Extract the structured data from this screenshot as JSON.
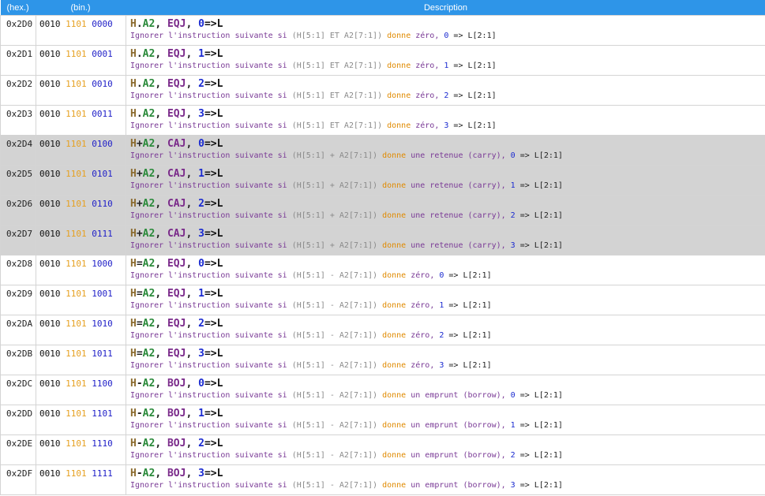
{
  "header": {
    "hex": "(hex.)",
    "bin": "(bin.)",
    "description": "Description"
  },
  "rows": [
    {
      "hex": "0x2D0",
      "bin": [
        "0010",
        "1101",
        "0000"
      ],
      "mn": {
        "h": "H",
        "op": ".",
        "a2": "A2",
        "sep1": ", ",
        "cmd": "EQJ",
        "sep2": ", ",
        "num": "0",
        "arr": "=>L"
      },
      "d": {
        "t1": "Ignorer l'instruction suivante si ",
        "expr": "(H[5:1] ET A2[7:1])",
        "donne": " donne ",
        "t2": "zéro, ",
        "num": "0",
        "dest": " => L[2:1]"
      },
      "grey": false
    },
    {
      "hex": "0x2D1",
      "bin": [
        "0010",
        "1101",
        "0001"
      ],
      "mn": {
        "h": "H",
        "op": ".",
        "a2": "A2",
        "sep1": ", ",
        "cmd": "EQJ",
        "sep2": ", ",
        "num": "1",
        "arr": "=>L"
      },
      "d": {
        "t1": "Ignorer l'instruction suivante si ",
        "expr": "(H[5:1] ET A2[7:1])",
        "donne": " donne ",
        "t2": "zéro, ",
        "num": "1",
        "dest": " => L[2:1]"
      },
      "grey": false
    },
    {
      "hex": "0x2D2",
      "bin": [
        "0010",
        "1101",
        "0010"
      ],
      "mn": {
        "h": "H",
        "op": ".",
        "a2": "A2",
        "sep1": ", ",
        "cmd": "EQJ",
        "sep2": ", ",
        "num": "2",
        "arr": "=>L"
      },
      "d": {
        "t1": "Ignorer l'instruction suivante si ",
        "expr": "(H[5:1] ET A2[7:1])",
        "donne": " donne ",
        "t2": "zéro, ",
        "num": "2",
        "dest": " => L[2:1]"
      },
      "grey": false
    },
    {
      "hex": "0x2D3",
      "bin": [
        "0010",
        "1101",
        "0011"
      ],
      "mn": {
        "h": "H",
        "op": ".",
        "a2": "A2",
        "sep1": ", ",
        "cmd": "EQJ",
        "sep2": ", ",
        "num": "3",
        "arr": "=>L"
      },
      "d": {
        "t1": "Ignorer l'instruction suivante si ",
        "expr": "(H[5:1] ET A2[7:1])",
        "donne": " donne ",
        "t2": "zéro, ",
        "num": "3",
        "dest": " => L[2:1]"
      },
      "grey": false
    },
    {
      "hex": "0x2D4",
      "bin": [
        "0010",
        "1101",
        "0100"
      ],
      "mn": {
        "h": "H",
        "op": "+",
        "a2": "A2",
        "sep1": ", ",
        "cmd": "CAJ",
        "sep2": ", ",
        "num": "0",
        "arr": "=>L"
      },
      "d": {
        "t1": "Ignorer l'instruction suivante si ",
        "expr": "(H[5:1] + A2[7:1])",
        "donne": " donne ",
        "t2": "une retenue (carry), ",
        "num": "0",
        "dest": " => L[2:1]"
      },
      "grey": true
    },
    {
      "hex": "0x2D5",
      "bin": [
        "0010",
        "1101",
        "0101"
      ],
      "mn": {
        "h": "H",
        "op": "+",
        "a2": "A2",
        "sep1": ", ",
        "cmd": "CAJ",
        "sep2": ", ",
        "num": "1",
        "arr": "=>L"
      },
      "d": {
        "t1": "Ignorer l'instruction suivante si ",
        "expr": "(H[5:1] + A2[7:1])",
        "donne": " donne ",
        "t2": "une retenue (carry), ",
        "num": "1",
        "dest": " => L[2:1]"
      },
      "grey": true
    },
    {
      "hex": "0x2D6",
      "bin": [
        "0010",
        "1101",
        "0110"
      ],
      "mn": {
        "h": "H",
        "op": "+",
        "a2": "A2",
        "sep1": ", ",
        "cmd": "CAJ",
        "sep2": ", ",
        "num": "2",
        "arr": "=>L"
      },
      "d": {
        "t1": "Ignorer l'instruction suivante si ",
        "expr": "(H[5:1] + A2[7:1])",
        "donne": " donne ",
        "t2": "une retenue (carry), ",
        "num": "2",
        "dest": " => L[2:1]"
      },
      "grey": true
    },
    {
      "hex": "0x2D7",
      "bin": [
        "0010",
        "1101",
        "0111"
      ],
      "mn": {
        "h": "H",
        "op": "+",
        "a2": "A2",
        "sep1": ", ",
        "cmd": "CAJ",
        "sep2": ", ",
        "num": "3",
        "arr": "=>L"
      },
      "d": {
        "t1": "Ignorer l'instruction suivante si ",
        "expr": "(H[5:1] + A2[7:1])",
        "donne": " donne ",
        "t2": "une retenue (carry), ",
        "num": "3",
        "dest": " => L[2:1]"
      },
      "grey": true
    },
    {
      "hex": "0x2D8",
      "bin": [
        "0010",
        "1101",
        "1000"
      ],
      "mn": {
        "h": "H",
        "op": "=",
        "a2": "A2",
        "sep1": ", ",
        "cmd": "EQJ",
        "sep2": ", ",
        "num": "0",
        "arr": "=>L"
      },
      "d": {
        "t1": "Ignorer l'instruction suivante si ",
        "expr": "(H[5:1] - A2[7:1])",
        "donne": " donne ",
        "t2": "zéro, ",
        "num": "0",
        "dest": " => L[2:1]"
      },
      "grey": false
    },
    {
      "hex": "0x2D9",
      "bin": [
        "0010",
        "1101",
        "1001"
      ],
      "mn": {
        "h": "H",
        "op": "=",
        "a2": "A2",
        "sep1": ", ",
        "cmd": "EQJ",
        "sep2": ", ",
        "num": "1",
        "arr": "=>L"
      },
      "d": {
        "t1": "Ignorer l'instruction suivante si ",
        "expr": "(H[5:1] - A2[7:1])",
        "donne": " donne ",
        "t2": "zéro, ",
        "num": "1",
        "dest": " => L[2:1]"
      },
      "grey": false
    },
    {
      "hex": "0x2DA",
      "bin": [
        "0010",
        "1101",
        "1010"
      ],
      "mn": {
        "h": "H",
        "op": "=",
        "a2": "A2",
        "sep1": ", ",
        "cmd": "EQJ",
        "sep2": ", ",
        "num": "2",
        "arr": "=>L"
      },
      "d": {
        "t1": "Ignorer l'instruction suivante si ",
        "expr": "(H[5:1] - A2[7:1])",
        "donne": " donne ",
        "t2": "zéro, ",
        "num": "2",
        "dest": " => L[2:1]"
      },
      "grey": false
    },
    {
      "hex": "0x2DB",
      "bin": [
        "0010",
        "1101",
        "1011"
      ],
      "mn": {
        "h": "H",
        "op": "=",
        "a2": "A2",
        "sep1": ", ",
        "cmd": "EQJ",
        "sep2": ", ",
        "num": "3",
        "arr": "=>L"
      },
      "d": {
        "t1": "Ignorer l'instruction suivante si ",
        "expr": "(H[5:1] - A2[7:1])",
        "donne": " donne ",
        "t2": "zéro, ",
        "num": "3",
        "dest": " => L[2:1]"
      },
      "grey": false
    },
    {
      "hex": "0x2DC",
      "bin": [
        "0010",
        "1101",
        "1100"
      ],
      "mn": {
        "h": "H",
        "op": "-",
        "a2": "A2",
        "sep1": ", ",
        "cmd": "BOJ",
        "sep2": ", ",
        "num": "0",
        "arr": "=>L"
      },
      "d": {
        "t1": "Ignorer l'instruction suivante si ",
        "expr": "(H[5:1] - A2[7:1])",
        "donne": " donne ",
        "t2": "un emprunt (borrow), ",
        "num": "0",
        "dest": " => L[2:1]"
      },
      "grey": false
    },
    {
      "hex": "0x2DD",
      "bin": [
        "0010",
        "1101",
        "1101"
      ],
      "mn": {
        "h": "H",
        "op": "-",
        "a2": "A2",
        "sep1": ", ",
        "cmd": "BOJ",
        "sep2": ", ",
        "num": "1",
        "arr": "=>L"
      },
      "d": {
        "t1": "Ignorer l'instruction suivante si ",
        "expr": "(H[5:1] - A2[7:1])",
        "donne": " donne ",
        "t2": "un emprunt (borrow), ",
        "num": "1",
        "dest": " => L[2:1]"
      },
      "grey": false
    },
    {
      "hex": "0x2DE",
      "bin": [
        "0010",
        "1101",
        "1110"
      ],
      "mn": {
        "h": "H",
        "op": "-",
        "a2": "A2",
        "sep1": ", ",
        "cmd": "BOJ",
        "sep2": ", ",
        "num": "2",
        "arr": "=>L"
      },
      "d": {
        "t1": "Ignorer l'instruction suivante si ",
        "expr": "(H[5:1] - A2[7:1])",
        "donne": " donne ",
        "t2": "un emprunt (borrow), ",
        "num": "2",
        "dest": " => L[2:1]"
      },
      "grey": false
    },
    {
      "hex": "0x2DF",
      "bin": [
        "0010",
        "1101",
        "1111"
      ],
      "mn": {
        "h": "H",
        "op": "-",
        "a2": "A2",
        "sep1": ", ",
        "cmd": "BOJ",
        "sep2": ", ",
        "num": "3",
        "arr": "=>L"
      },
      "d": {
        "t1": "Ignorer l'instruction suivante si ",
        "expr": "(H[5:1] - A2[7:1])",
        "donne": " donne ",
        "t2": "un emprunt (borrow), ",
        "num": "3",
        "dest": " => L[2:1]"
      },
      "grey": false
    }
  ]
}
